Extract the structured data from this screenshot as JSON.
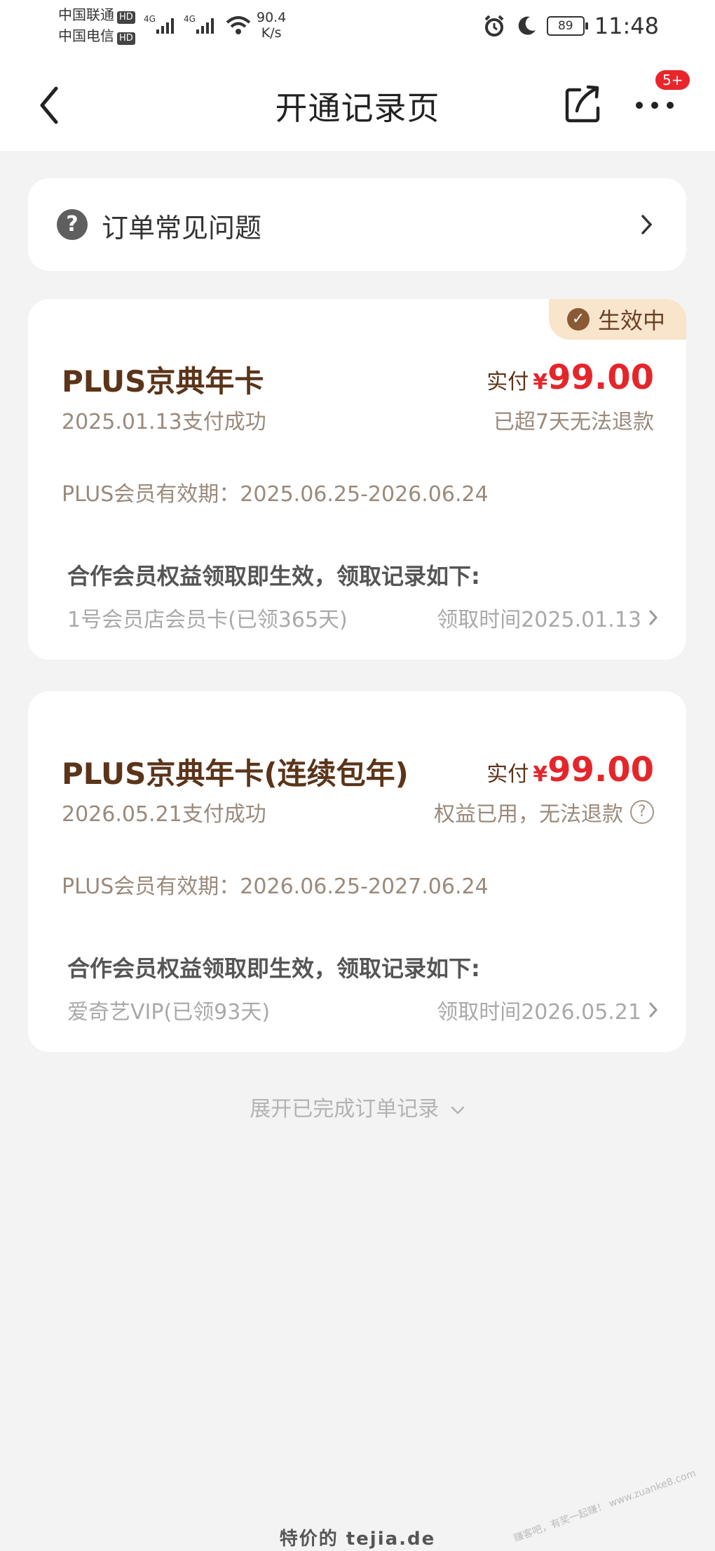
{
  "status_bar": {
    "carrier1": "中国联通",
    "carrier2": "中国电信",
    "hd": "HD",
    "net": "4G",
    "speed_value": "90.4",
    "speed_unit": "K/s",
    "battery": "89",
    "time": "11:48"
  },
  "nav": {
    "title": "开通记录页",
    "badge": "5+"
  },
  "faq": {
    "label": "订单常见问题"
  },
  "orders": [
    {
      "status": "生效中",
      "name": "PLUS京典年卡",
      "pay_date": "2025.01.13支付成功",
      "paid_label": "实付",
      "currency": "¥",
      "amount": "99.00",
      "refund_note": "已超7天无法退款",
      "validity": "PLUS会员有效期：2025.06.25-2026.06.24",
      "benefit_title": "合作会员权益领取即生效，领取记录如下:",
      "benefit_item": "1号会员店会员卡(已领365天)",
      "benefit_time": "领取时间2025.01.13"
    },
    {
      "name": "PLUS京典年卡(连续包年)",
      "pay_date": "2026.05.21支付成功",
      "paid_label": "实付",
      "currency": "¥",
      "amount": "99.00",
      "refund_note": "权益已用，无法退款",
      "validity": "PLUS会员有效期：2026.06.25-2027.06.24",
      "benefit_title": "合作会员权益领取即生效，领取记录如下:",
      "benefit_item": "爱奇艺VIP(已领93天)",
      "benefit_time": "领取时间2026.05.21"
    }
  ],
  "expand_label": "展开已完成订单记录",
  "footer_watermark": "特价的 tejia.de",
  "corner_watermark": "赚客吧，有奖一起赚！ www.zuanke8.com",
  "colors": {
    "accent_red": "#e4262b",
    "brown": "#5b3419",
    "card_top": "#fdf3e9"
  }
}
